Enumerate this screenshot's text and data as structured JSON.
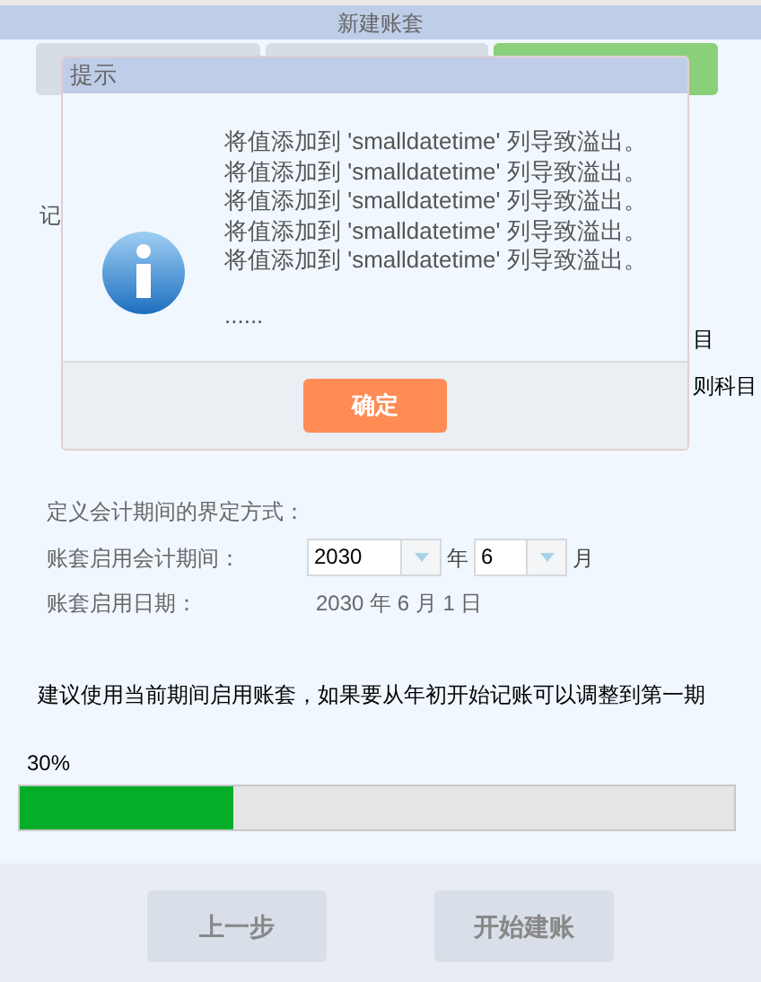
{
  "window": {
    "title": "新建账套"
  },
  "steps": [
    {
      "selected": false
    },
    {
      "selected": false
    },
    {
      "selected": true
    }
  ],
  "background_texts": {
    "left": "记",
    "right_1": "目",
    "right_2": "则科目"
  },
  "dialog": {
    "title": "提示",
    "message_lines": [
      "将值添加到 'smalldatetime' 列导致溢出。",
      "将值添加到 'smalldatetime' 列导致溢出。",
      "将值添加到 'smalldatetime' 列导致溢出。",
      "将值添加到 'smalldatetime' 列导致溢出。",
      "将值添加到 'smalldatetime' 列导致溢出。"
    ],
    "ellipsis": "......",
    "ok_button": "确定"
  },
  "period": {
    "heading": "定义会计期间的界定方式：",
    "period_label": "账套启用会计期间：",
    "year": "2030",
    "year_unit": "年",
    "month": "6",
    "month_unit": "月",
    "date_label": "账套启用日期：",
    "date_value": "2030 年 6 月 1 日"
  },
  "suggestion": "建议使用当前期间启用账套，如果要从年初开始记账可以调整到第一期",
  "progress": {
    "reading": "30%",
    "level": 0.3
  },
  "buttons": [
    "上一步",
    "开始建账"
  ]
}
